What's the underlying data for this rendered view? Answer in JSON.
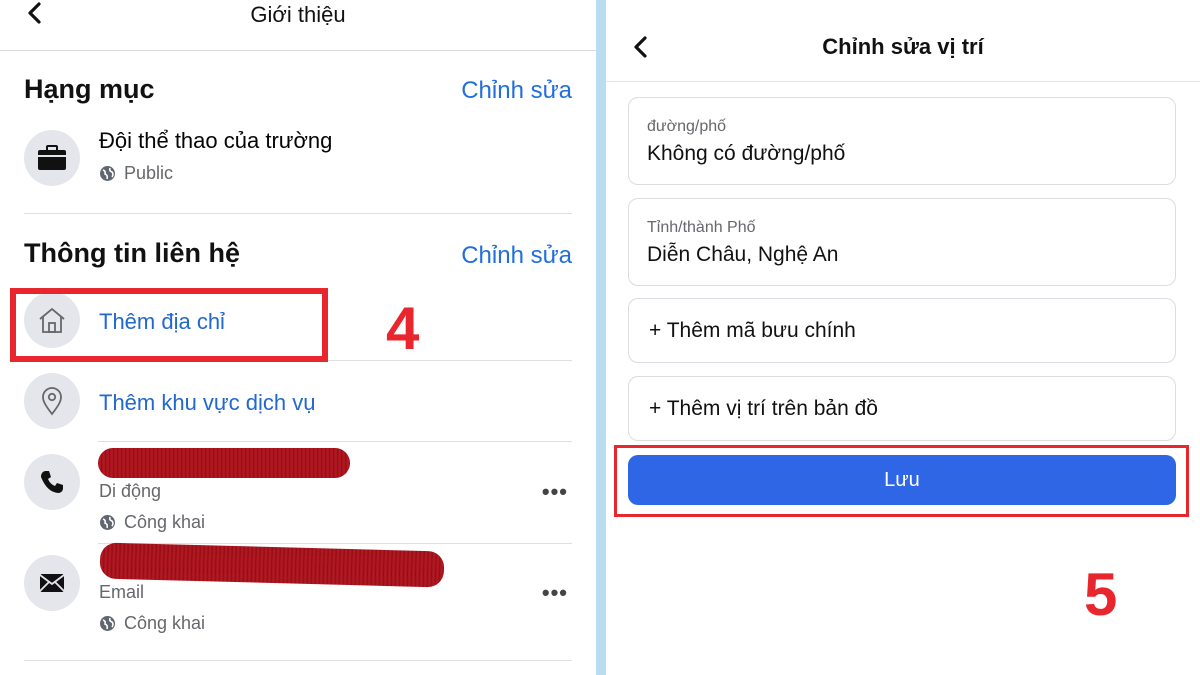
{
  "left": {
    "header_title": "Giới thiệu",
    "category": {
      "title": "Hạng mục",
      "edit_label": "Chỉnh sửa",
      "item_name": "Đội thể thao của trường",
      "item_privacy": "Public"
    },
    "contact": {
      "title": "Thông tin liên hệ",
      "edit_label": "Chỉnh sửa",
      "add_address": "Thêm địa chỉ",
      "add_service_area": "Thêm khu vực dịch vụ",
      "phone_type": "Di động",
      "phone_privacy": "Công khai",
      "email_type": "Email",
      "email_privacy": "Công khai",
      "more_label": "•••"
    },
    "annotation_step": "4"
  },
  "right": {
    "header_title": "Chỉnh sửa vị trí",
    "street": {
      "label": "đường/phố",
      "value": "Không có đường/phố"
    },
    "city": {
      "label": "Tỉnh/thành Phố",
      "value": "Diễn Châu, Nghệ An"
    },
    "add_postal_code": "+ Thêm mã bưu chính",
    "add_map_location": "+ Thêm vị trí trên bản đồ",
    "save_label": "Lưu",
    "annotation_step": "5"
  },
  "icons": [
    "back-chevron-icon",
    "briefcase-icon",
    "globe-icon",
    "home-icon",
    "location-pin-icon",
    "phone-icon",
    "envelope-icon",
    "more-dots-icon"
  ],
  "colors": {
    "link_blue": "#216fdb",
    "save_blue": "#2f66e6",
    "annotation_red": "#e8262e",
    "divider": "#b9dcee"
  }
}
